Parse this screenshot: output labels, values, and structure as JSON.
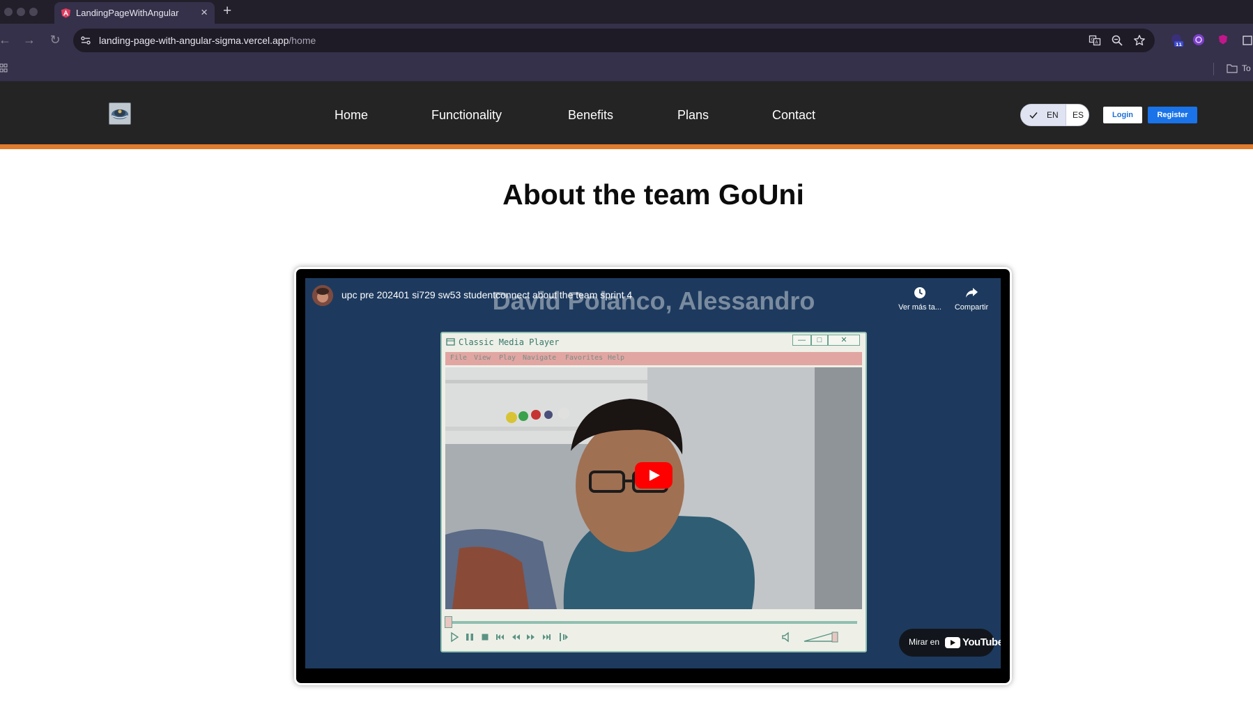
{
  "browser": {
    "tab_title": "LandingPageWithAngular",
    "tab_close": "×",
    "new_tab": "+",
    "url_host": "landing-page-with-angular-sigma.vercel.app",
    "url_path": "/home",
    "extension_badge": "11",
    "bookmark_folder_label": "To"
  },
  "header": {
    "nav": [
      "Home",
      "Functionality",
      "Benefits",
      "Plans",
      "Contact"
    ],
    "lang_en": "EN",
    "lang_es": "ES",
    "login_label": "Login",
    "register_label": "Register",
    "accent_color": "#e07b2d",
    "background_color": "#242424"
  },
  "main": {
    "title": "About the team GoUni",
    "video": {
      "title": "upc pre 202401 si729 sw53 studentconnect about the team sprint 4",
      "overlay_name": "David Polanco, Alessandro",
      "watch_later_label": "Ver más ta...",
      "share_label": "Compartir",
      "watch_on_label": "Mirar en",
      "brand": "YouTube",
      "player": {
        "window_title": "Classic Media Player",
        "menu": [
          "File",
          "View",
          "Play",
          "Navigate",
          "Favorites",
          "Help"
        ],
        "min": "—",
        "max": "□",
        "close": "✕"
      }
    }
  }
}
